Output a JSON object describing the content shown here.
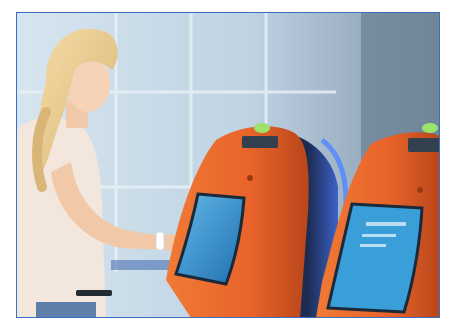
{
  "image": {
    "frame_color": "#3b6fc4"
  },
  "scene": {
    "kiosk_1": {
      "body_color": "#e8632a",
      "screen_color": "#2f8fd0",
      "indicator_color": "#9be36a"
    },
    "kiosk_2": {
      "body_color": "#e8632a",
      "screen_color": "#3a9ed8",
      "indicator_color": "#9be36a"
    },
    "background_color": "#c9dbe8",
    "person_hair_color": "#e9c98c"
  }
}
